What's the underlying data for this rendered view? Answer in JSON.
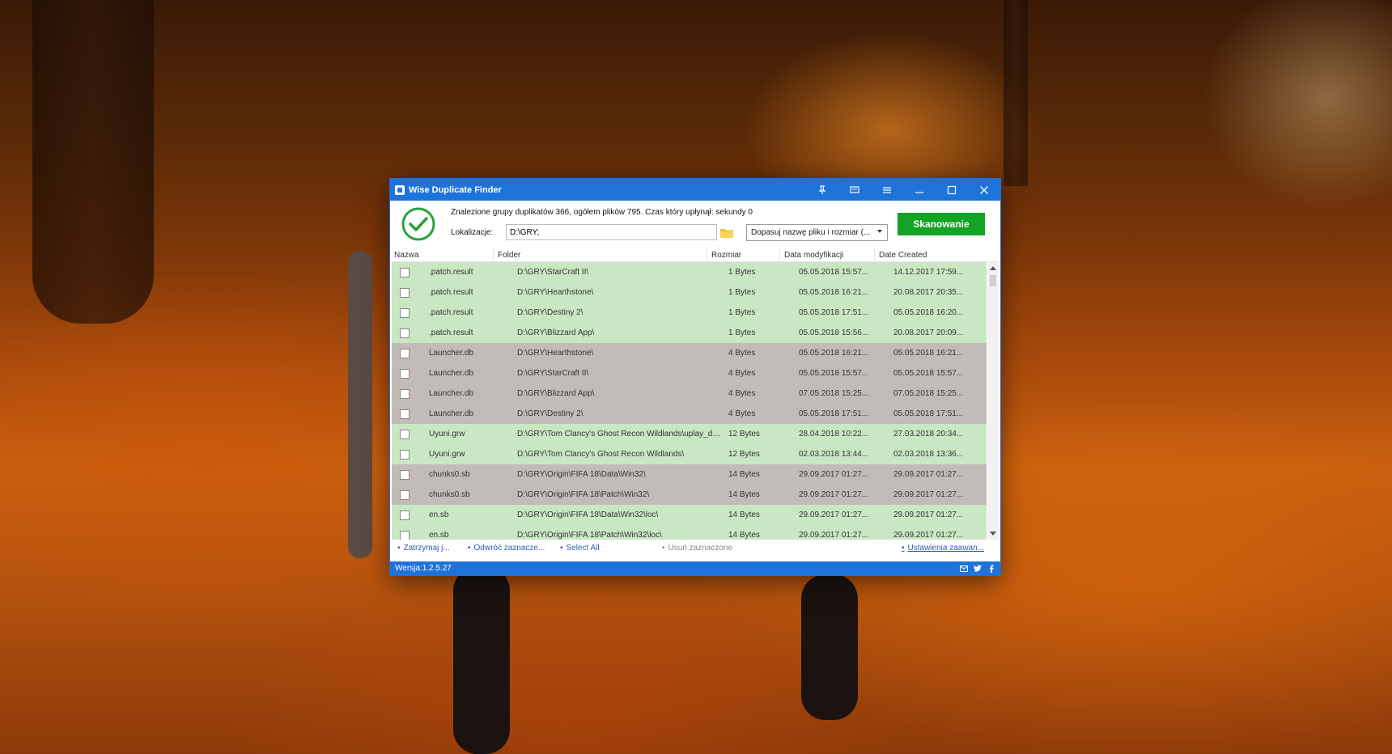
{
  "window": {
    "title": "Wise Duplicate Finder",
    "accent_color": "#1e73db",
    "titlebar_icons": [
      "pin-icon",
      "feedback-icon",
      "menu-icon",
      "minimize-icon",
      "maximize-icon",
      "close-icon"
    ]
  },
  "header": {
    "summary": "Znalezione grupy duplikatów 366, ogółem plików 795. Czas który upłynął: sekundy 0",
    "location_label": "Lokalizacje:",
    "location_value": "D:\\GRY;",
    "match_mode": "Dopasuj nazwę pliku i rozmiar (...",
    "scan_button": "Skanowanie",
    "scan_color": "#14a325"
  },
  "columns": [
    "Nazwa",
    "Folder",
    "Rozmiar",
    "Data modyfikacji",
    "Date Created"
  ],
  "rows": [
    {
      "name": ".patch.result",
      "folder": "D:\\GRY\\StarCraft II\\",
      "size": "1 Bytes",
      "modified": "05.05.2018 15:57...",
      "created": "14.12.2017 17:59...",
      "group": "g"
    },
    {
      "name": ".patch.result",
      "folder": "D:\\GRY\\Hearthstone\\",
      "size": "1 Bytes",
      "modified": "05.05.2018 16:21...",
      "created": "20.08.2017 20:35...",
      "group": "g"
    },
    {
      "name": ".patch.result",
      "folder": "D:\\GRY\\Destiny 2\\",
      "size": "1 Bytes",
      "modified": "05.05.2018 17:51...",
      "created": "05.05.2018 16:20...",
      "group": "g"
    },
    {
      "name": ".patch.result",
      "folder": "D:\\GRY\\Blizzard App\\",
      "size": "1 Bytes",
      "modified": "05.05.2018 15:56...",
      "created": "20.08.2017 20:09...",
      "group": "g"
    },
    {
      "name": "Launcher.db",
      "folder": "D:\\GRY\\Hearthstone\\",
      "size": "4 Bytes",
      "modified": "05.05.2018 16:21...",
      "created": "05.05.2018 16:21...",
      "group": "r"
    },
    {
      "name": "Launcher.db",
      "folder": "D:\\GRY\\StarCraft II\\",
      "size": "4 Bytes",
      "modified": "05.05.2018 15:57...",
      "created": "05.05.2018 15:57...",
      "group": "r"
    },
    {
      "name": "Launcher.db",
      "folder": "D:\\GRY\\Blizzard App\\",
      "size": "4 Bytes",
      "modified": "07.05.2018 15:25...",
      "created": "07.05.2018 15:25...",
      "group": "r"
    },
    {
      "name": "Launcher.db",
      "folder": "D:\\GRY\\Destiny 2\\",
      "size": "4 Bytes",
      "modified": "05.05.2018 17:51...",
      "created": "05.05.2018 17:51...",
      "group": "r"
    },
    {
      "name": "Uyuni.grw",
      "folder": "D:\\GRY\\Tom Clancy's Ghost Recon Wildlands\\uplay_dow...",
      "size": "12 Bytes",
      "modified": "28.04.2018 10:22...",
      "created": "27.03.2018 20:34...",
      "group": "g"
    },
    {
      "name": "Uyuni.grw",
      "folder": "D:\\GRY\\Tom Clancy's Ghost Recon Wildlands\\",
      "size": "12 Bytes",
      "modified": "02.03.2018 13:44...",
      "created": "02.03.2018 13:36...",
      "group": "g"
    },
    {
      "name": "chunks0.sb",
      "folder": "D:\\GRY\\Origin\\FIFA 18\\Data\\Win32\\",
      "size": "14 Bytes",
      "modified": "29.09.2017 01:27...",
      "created": "29.09.2017 01:27...",
      "group": "r"
    },
    {
      "name": "chunks0.sb",
      "folder": "D:\\GRY\\Origin\\FIFA 18\\Patch\\Win32\\",
      "size": "14 Bytes",
      "modified": "29.09.2017 01:27...",
      "created": "29.09.2017 01:27...",
      "group": "r"
    },
    {
      "name": "en.sb",
      "folder": "D:\\GRY\\Origin\\FIFA 18\\Data\\Win32\\loc\\",
      "size": "14 Bytes",
      "modified": "29.09.2017 01:27...",
      "created": "29.09.2017 01:27...",
      "group": "g"
    },
    {
      "name": "en.sb",
      "folder": "D:\\GRY\\Origin\\FIFA 18\\Patch\\Win32\\loc\\",
      "size": "14 Bytes",
      "modified": "29.09.2017 01:27...",
      "created": "29.09.2017 01:27...",
      "group": "g"
    }
  ],
  "actions": {
    "stop": "Zatrzymaj j...",
    "invert": "Odwróć zaznacze...",
    "select_all": "Select All",
    "delete_selected": "Usuń zaznaczone",
    "advanced": "Ustawienia zaawan..."
  },
  "status": {
    "version": "Wersja:1.2.5.27",
    "social_icons": [
      "email-icon",
      "twitter-icon",
      "facebook-icon"
    ]
  }
}
